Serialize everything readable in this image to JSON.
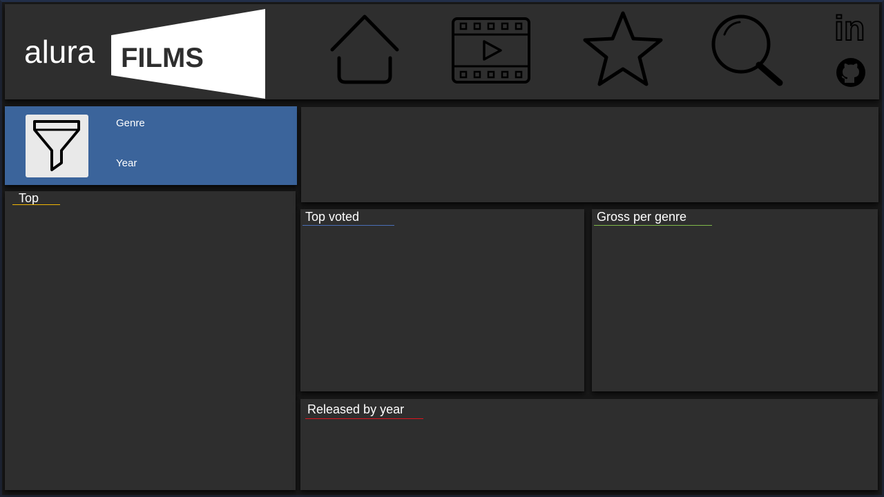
{
  "app": {
    "logo_text_left": "alura",
    "logo_text_right": "FILMS"
  },
  "nav": [
    {
      "name": "home",
      "icon": "home-icon"
    },
    {
      "name": "films",
      "icon": "film-play-icon"
    },
    {
      "name": "favorites",
      "icon": "star-icon"
    },
    {
      "name": "search",
      "icon": "search-icon"
    }
  ],
  "social": [
    {
      "name": "linkedin",
      "icon": "linkedin-icon",
      "text": "in"
    },
    {
      "name": "github",
      "icon": "github-icon"
    }
  ],
  "filters": {
    "icon": "filter-icon",
    "genre_label": "Genre",
    "year_label": "Year"
  },
  "sections": {
    "top": "Top",
    "top_voted": "Top voted",
    "gross_per_genre": "Gross per genre",
    "released_by_year": "Released by year"
  },
  "colors": {
    "background": "#1a1a1a",
    "panel": "#2e2e2e",
    "filter_panel": "#3b649b",
    "accent_top": "#f2b705",
    "accent_top_voted": "#4a6fb8",
    "accent_gross": "#7fb94a",
    "accent_released": "#e0141e"
  }
}
